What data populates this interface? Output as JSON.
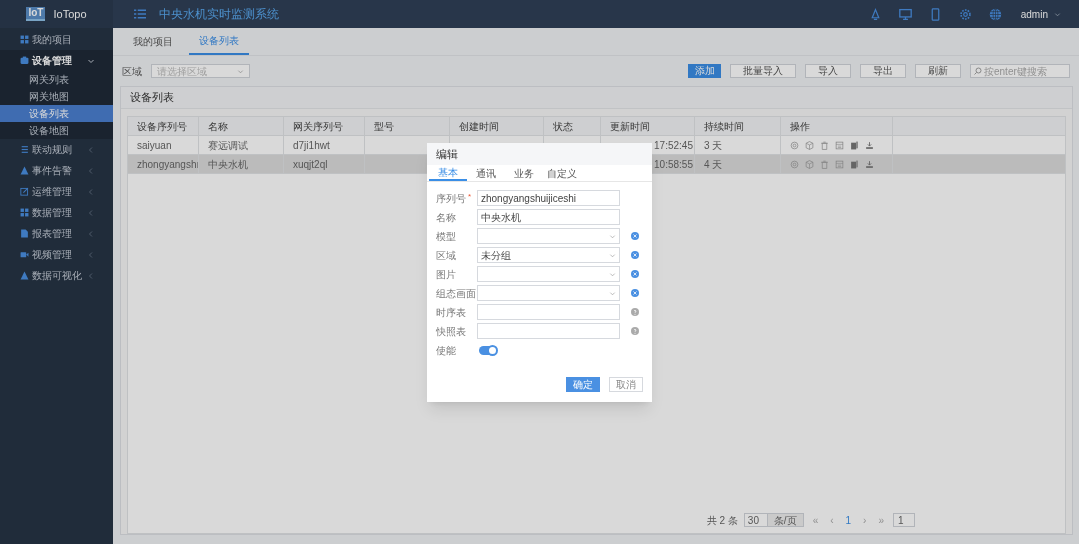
{
  "brand": {
    "logo": "IoT",
    "name": "IoTopo"
  },
  "header": {
    "title": "中央水机实时监测系统",
    "user": "admin"
  },
  "sidebar": {
    "items": [
      {
        "label": "我的项目",
        "expanded": false
      },
      {
        "label": "设备管理",
        "expanded": true,
        "children": [
          {
            "label": "网关列表",
            "selected": false
          },
          {
            "label": "网关地图",
            "selected": false
          },
          {
            "label": "设备列表",
            "selected": true
          },
          {
            "label": "设备地图",
            "selected": false
          }
        ]
      },
      {
        "label": "联动规则",
        "expanded": false
      },
      {
        "label": "事件告警",
        "expanded": false
      },
      {
        "label": "运维管理",
        "expanded": false
      },
      {
        "label": "数据管理",
        "expanded": false
      },
      {
        "label": "报表管理",
        "expanded": false
      },
      {
        "label": "视频管理",
        "expanded": false
      },
      {
        "label": "数据可视化",
        "expanded": false
      }
    ]
  },
  "tabs": [
    {
      "label": "我的项目",
      "selected": false
    },
    {
      "label": "设备列表",
      "selected": true
    }
  ],
  "toolbar": {
    "region_label": "区域",
    "region_placeholder": "请选择区域",
    "buttons": [
      {
        "label": "添加",
        "kind": "primary"
      },
      {
        "label": "批量导入",
        "kind": "default"
      },
      {
        "label": "导入",
        "kind": "default"
      },
      {
        "label": "导出",
        "kind": "default"
      },
      {
        "label": "刷新",
        "kind": "default"
      }
    ],
    "search_placeholder": "按enter键搜索"
  },
  "panel": {
    "title": "设备列表"
  },
  "table": {
    "columns": [
      "设备序列号",
      "名称",
      "网关序列号",
      "型号",
      "创建时间",
      "状态",
      "更新时间",
      "持续时间",
      "操作"
    ],
    "rows": [
      {
        "selected": false,
        "serial": "saiyuan",
        "name": "赛远调试",
        "gateway": "d7ji1hwt",
        "updated": "17:52:45",
        "duration": "3 天"
      },
      {
        "selected": true,
        "serial": "zhongyangshı",
        "name": "中央水机",
        "gateway": "xuqjt2ql",
        "updated": "10:58:55",
        "duration": "4 天"
      }
    ]
  },
  "pagination": {
    "total": "共 2 条",
    "page_size": "30",
    "page_size_unit": "条/页",
    "first": "«",
    "prev": "‹",
    "current": "1",
    "next": "›",
    "last": "»",
    "jump": "1"
  },
  "dialog": {
    "title": "编辑",
    "tabs": [
      {
        "label": "基本",
        "selected": true
      },
      {
        "label": "通讯",
        "selected": false
      },
      {
        "label": "业务",
        "selected": false
      },
      {
        "label": "自定义",
        "selected": false
      }
    ],
    "fields": [
      {
        "label": "序列号",
        "required_mark": "*",
        "kind": "text",
        "value": "zhongyangshuijiceshi"
      },
      {
        "label": "名称",
        "kind": "text",
        "value": "中央水机"
      },
      {
        "label": "模型",
        "kind": "select",
        "clearable": true
      },
      {
        "label": "区域",
        "kind": "select",
        "value": "未分组",
        "clearable": true
      },
      {
        "label": "图片",
        "kind": "select",
        "clearable": true
      },
      {
        "label": "组态画面",
        "kind": "select",
        "clearable": true
      },
      {
        "label": "时序表",
        "kind": "text",
        "help": true
      },
      {
        "label": "快照表",
        "kind": "text",
        "help": true
      },
      {
        "label": "使能",
        "kind": "toggle",
        "on": true
      }
    ],
    "buttons": [
      {
        "label": "确定",
        "kind": "primary"
      },
      {
        "label": "取消",
        "kind": "default"
      }
    ]
  }
}
